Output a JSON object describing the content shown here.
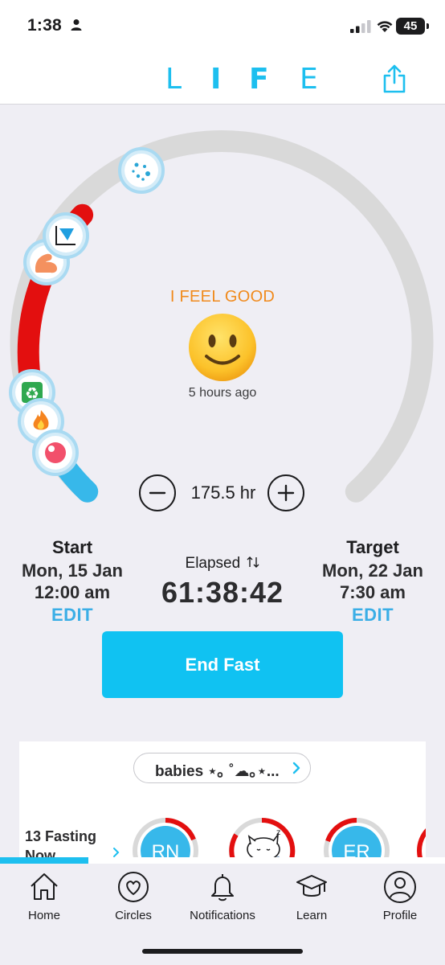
{
  "status_bar": {
    "time": "1:38",
    "battery": "45"
  },
  "header": {
    "logo_letters": [
      "L",
      "I",
      "F",
      "E"
    ],
    "accent": "#1dbfef"
  },
  "dial": {
    "stage_icons": [
      "bacteria-icon",
      "chart-icon",
      "muscle-icon",
      "recycle-icon",
      "flame-icon",
      "blood-drop-icon"
    ],
    "progress_color": "#e30f0f",
    "remaining_color": "#d9d9d9",
    "start_color": "#37b8ea"
  },
  "mood": {
    "label": "I FEEL GOOD",
    "time_ago": "5 hours ago"
  },
  "duration": {
    "value": "175.5 hr"
  },
  "start": {
    "title": "Start",
    "date": "Mon, 15 Jan",
    "time": "12:00 am",
    "edit": "EDIT"
  },
  "elapsed": {
    "label": "Elapsed",
    "value": "61:38:42"
  },
  "target": {
    "title": "Target",
    "date": "Mon, 22 Jan",
    "time": "7:30 am",
    "edit": "EDIT"
  },
  "end_fast_label": "End Fast",
  "circle": {
    "name": "babies ⋆｡ ˚☁︎｡⋆...",
    "fasting_count_label": "13 Fasting Now",
    "members": [
      {
        "initials": "RN",
        "color": "#37b8ea"
      },
      {
        "initials": "",
        "color": "#ffffff"
      },
      {
        "initials": "ER",
        "color": "#37b8ea"
      }
    ]
  },
  "tabs": [
    {
      "label": "Home",
      "icon": "home-icon"
    },
    {
      "label": "Circles",
      "icon": "heart-circle-icon"
    },
    {
      "label": "Notifications",
      "icon": "bell-icon"
    },
    {
      "label": "Learn",
      "icon": "graduation-cap-icon"
    },
    {
      "label": "Profile",
      "icon": "person-icon"
    }
  ]
}
